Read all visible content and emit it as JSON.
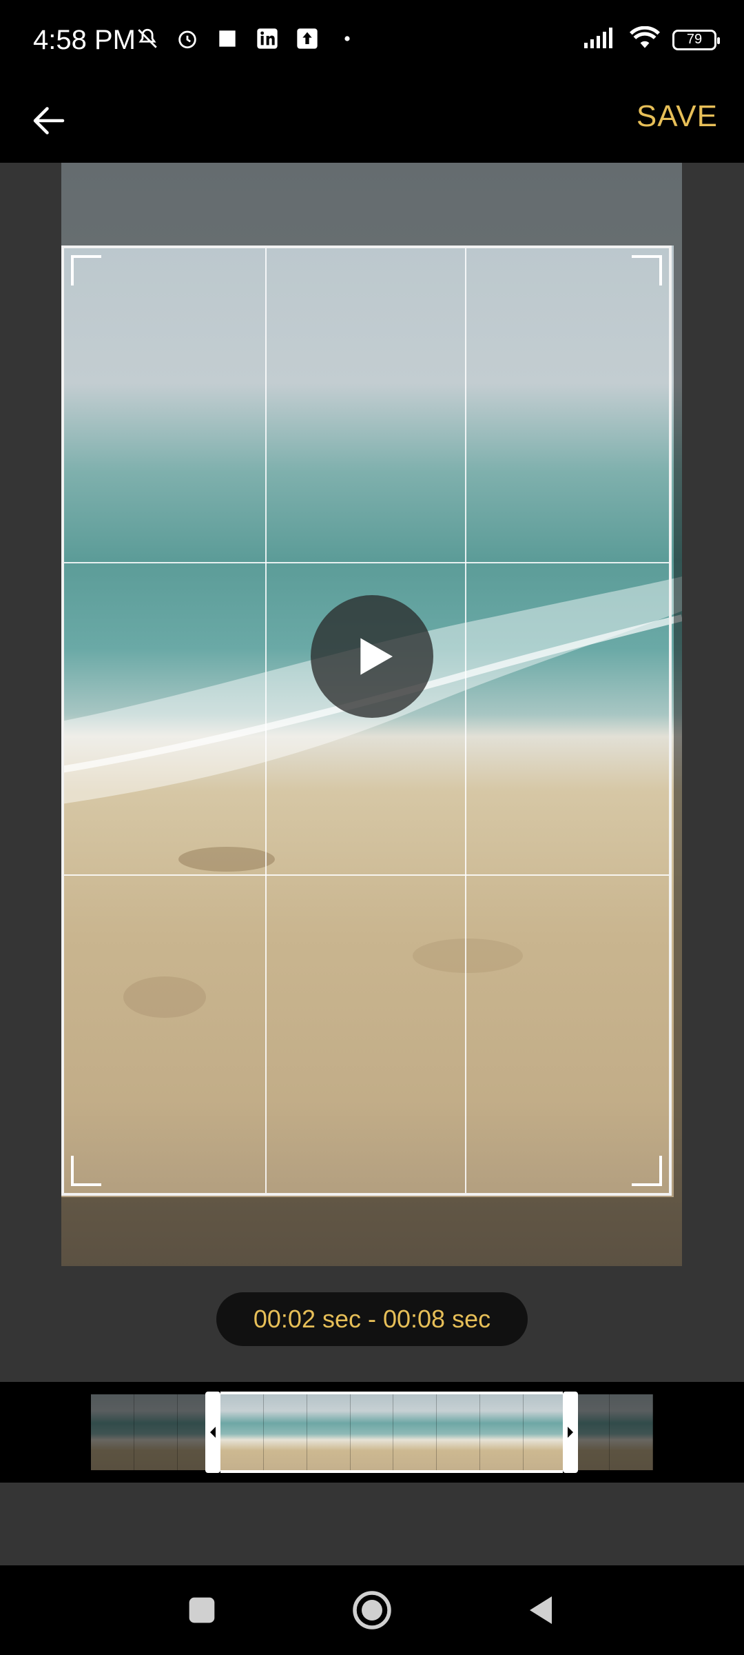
{
  "status": {
    "time": "4:58 PM",
    "battery": "79",
    "icons": [
      "mute-icon",
      "alarm-icon",
      "square-icon",
      "linkedin-icon",
      "upload-icon",
      "dot-icon",
      "signal-icon",
      "wifi-icon",
      "battery-icon"
    ]
  },
  "toolbar": {
    "back_icon": "arrow-left-icon",
    "save_label": "SAVE"
  },
  "editor": {
    "time_range": "00:02 sec - 00:08 sec",
    "play_icon": "play-icon"
  },
  "timeline": {
    "thumb_count": 13,
    "selection_start_fraction": 0.23,
    "selection_end_fraction": 0.84
  },
  "nav": {
    "icons": [
      "square-recents-icon",
      "circle-home-icon",
      "triangle-back-icon"
    ]
  }
}
